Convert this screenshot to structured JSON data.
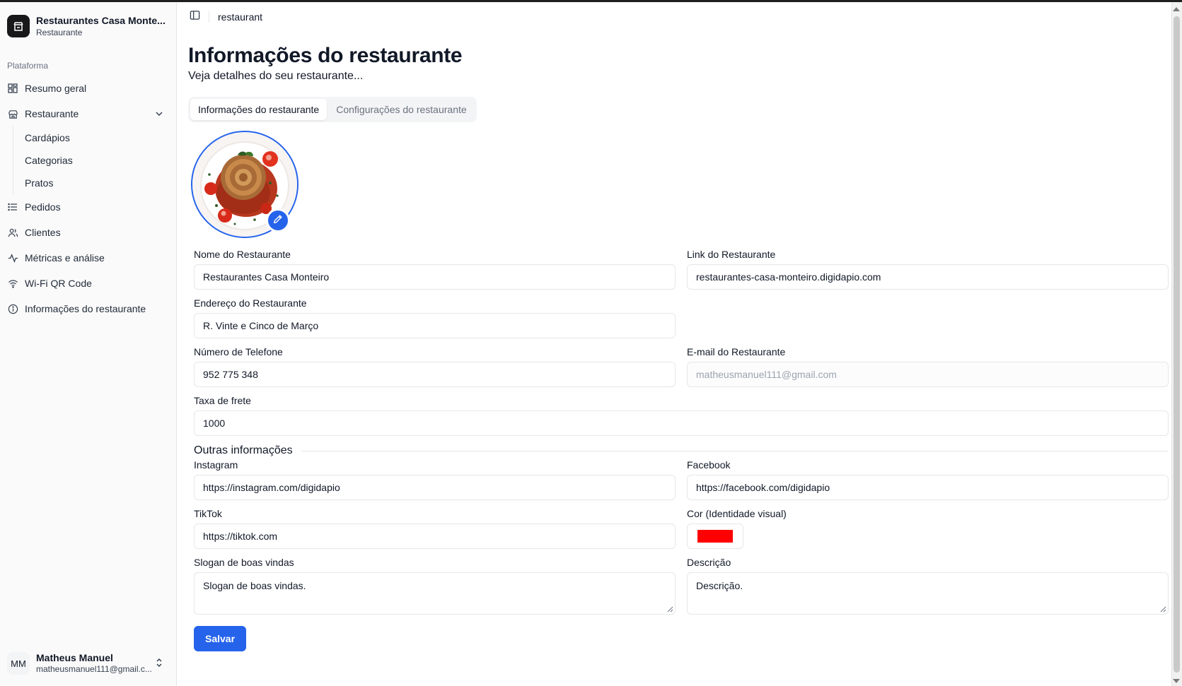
{
  "brand": {
    "name": "Restaurantes Casa Monte...",
    "subtitle": "Restaurante"
  },
  "sidebar": {
    "section_label": "Plataforma",
    "items": [
      {
        "label": "Resumo geral",
        "icon": "dashboard-icon"
      },
      {
        "label": "Restaurante",
        "icon": "store-icon",
        "expanded": true,
        "children": [
          {
            "label": "Cardápios"
          },
          {
            "label": "Categorias"
          },
          {
            "label": "Pratos"
          }
        ]
      },
      {
        "label": "Pedidos",
        "icon": "list-icon"
      },
      {
        "label": "Clientes",
        "icon": "users-icon"
      },
      {
        "label": "Métricas e análise",
        "icon": "activity-icon"
      },
      {
        "label": "Wi-Fi QR Code",
        "icon": "wifi-icon"
      },
      {
        "label": "Informações do restaurante",
        "icon": "info-icon"
      }
    ]
  },
  "user": {
    "initials": "MM",
    "name": "Matheus Manuel",
    "email": "matheusmanuel111@gmail.c..."
  },
  "header": {
    "breadcrumb": "restaurant"
  },
  "page": {
    "title": "Informações do restaurante",
    "subtitle": "Veja detalhes do seu restaurante...",
    "tabs": [
      {
        "label": "Informações do restaurante",
        "active": true
      },
      {
        "label": "Configurações do restaurante",
        "active": false
      }
    ]
  },
  "form": {
    "name": {
      "label": "Nome do Restaurante",
      "value": "Restaurantes Casa Monteiro"
    },
    "link": {
      "label": "Link do Restaurante",
      "value": "restaurantes-casa-monteiro.digidapio.com"
    },
    "address": {
      "label": "Endereço do Restaurante",
      "value": "R. Vinte e Cinco de Março"
    },
    "phone": {
      "label": "Número de Telefone",
      "value": "952 775 348"
    },
    "email": {
      "label": "E-mail do Restaurante",
      "value": "matheusmanuel111@gmail.com"
    },
    "shipping": {
      "label": "Taxa de frete",
      "value": "1000"
    },
    "other_heading": "Outras informações",
    "instagram": {
      "label": "Instagram",
      "value": "https://instagram.com/digidapio"
    },
    "facebook": {
      "label": "Facebook",
      "value": "https://facebook.com/digidapio"
    },
    "tiktok": {
      "label": "TikTok",
      "value": "https://tiktok.com"
    },
    "color": {
      "label": "Cor (Identidade visual)",
      "value": "#ff0000"
    },
    "slogan": {
      "label": "Slogan de boas vindas",
      "value": "Slogan de boas vindas."
    },
    "description": {
      "label": "Descrição",
      "value": "Descrição."
    },
    "save_label": "Salvar"
  },
  "colors": {
    "accent": "#2563eb",
    "brand_color": "#ff0000",
    "sidebar_bg": "#fafafa"
  }
}
